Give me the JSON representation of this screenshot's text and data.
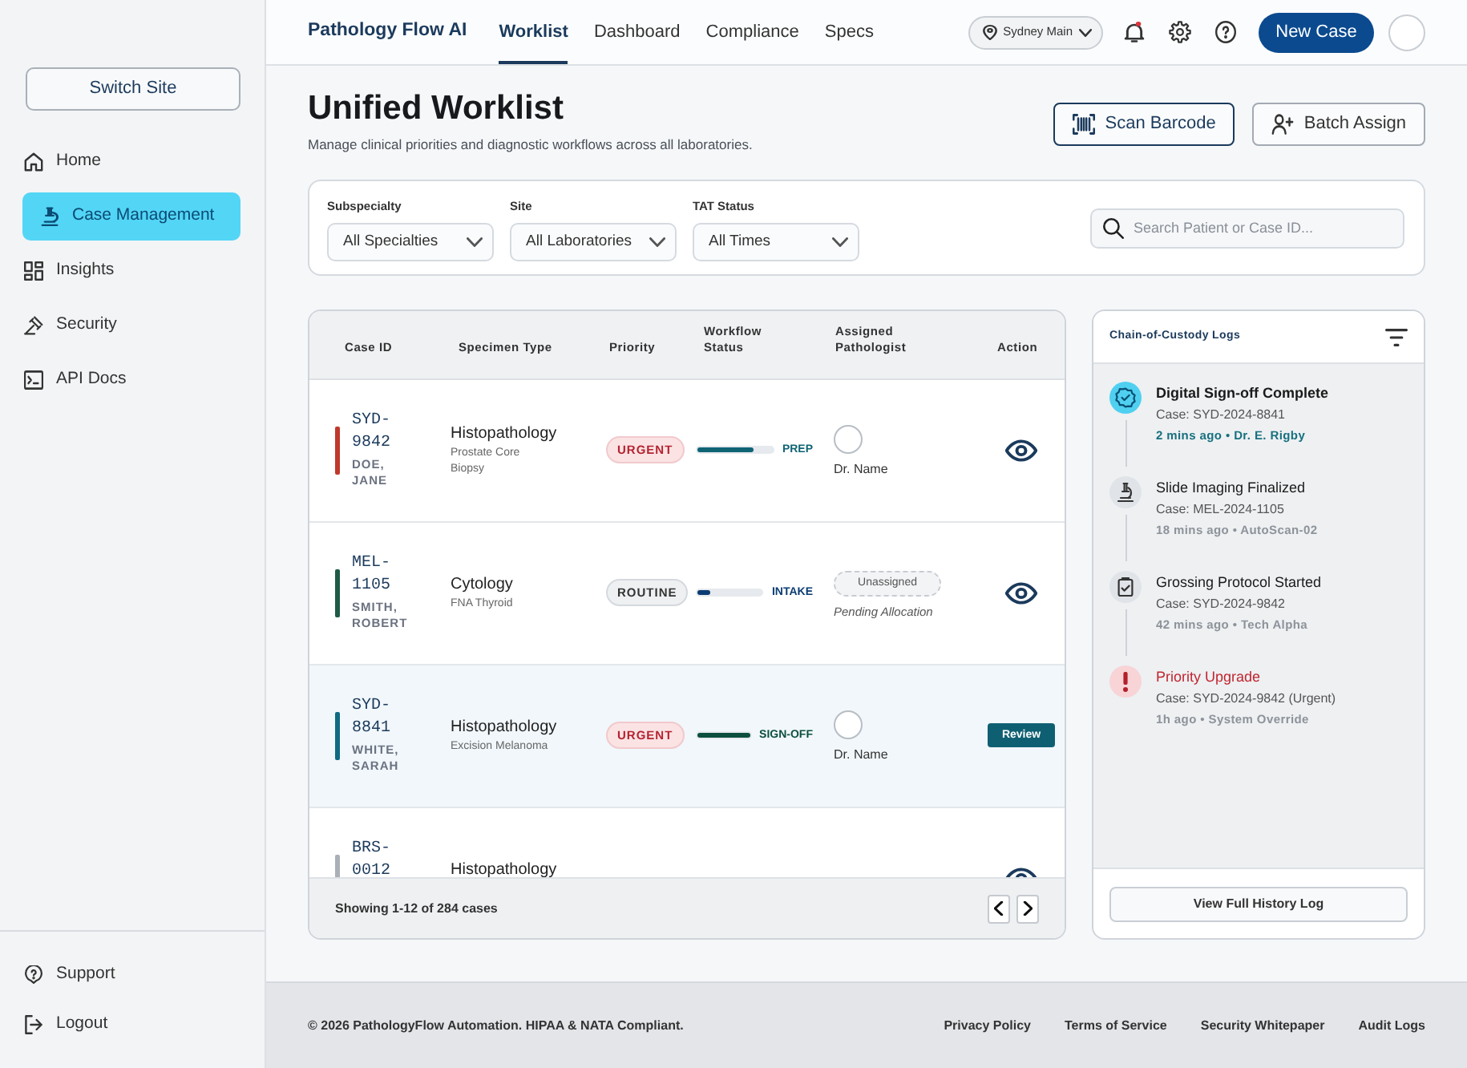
{
  "sidebar": {
    "switch_button": "Switch Site",
    "items": [
      {
        "label": "Home",
        "selected": false
      },
      {
        "label": "Case Management",
        "selected": true
      },
      {
        "label": "Insights",
        "selected": false
      },
      {
        "label": "Security",
        "selected": false
      },
      {
        "label": "API Docs",
        "selected": false
      }
    ],
    "bottom_items": [
      {
        "label": "Support"
      },
      {
        "label": "Logout"
      }
    ]
  },
  "topbar": {
    "brand": "Pathology Flow AI",
    "tabs": [
      {
        "label": "Worklist",
        "selected": true
      },
      {
        "label": "Dashboard",
        "selected": false
      },
      {
        "label": "Compliance",
        "selected": false
      },
      {
        "label": "Specs",
        "selected": false
      }
    ],
    "location": "Sydney Main",
    "notifications_unread": true,
    "new_case_button": "New Case"
  },
  "header": {
    "title": "Unified Worklist",
    "subtitle": "Manage clinical priorities and diagnostic workflows across all laboratories.",
    "buttons": [
      {
        "label": "Scan Barcode",
        "kind": "primary"
      },
      {
        "label": "Batch Assign",
        "kind": "secondary"
      }
    ]
  },
  "filters": [
    {
      "label": "Subspecialty",
      "value": "All Specialties"
    },
    {
      "label": "Site",
      "value": "All Laboratories"
    },
    {
      "label": "TAT Status",
      "value": "All Times"
    }
  ],
  "search": {
    "placeholder": "Search Patient or Case ID..."
  },
  "table": {
    "columns": [
      "Case ID",
      "Specimen Type",
      "Priority",
      "Workflow Status",
      "Assigned Pathologist",
      "Action"
    ],
    "rows": [
      {
        "case_id": "SYD-9842",
        "patient": "DOE, JANE",
        "color": "#c0392b",
        "selected": false,
        "specimen": "Histopathology",
        "detail": "Prostate Core Biopsy",
        "priority": {
          "label": "URGENT",
          "kind": "urgent"
        },
        "status": {
          "label": "PREP",
          "level": 0.75,
          "color": "#0f6474"
        },
        "pathologist": {
          "kind": "assigned",
          "name": "Dr. Name"
        },
        "action": {
          "kind": "view"
        }
      },
      {
        "case_id": "MEL-1105",
        "patient": "SMITH, ROBERT",
        "color": "#1e5a46",
        "selected": false,
        "specimen": "Cytology",
        "detail": "FNA Thyroid",
        "priority": {
          "label": "ROUTINE",
          "kind": "routine"
        },
        "status": {
          "label": "INTAKE",
          "level": 0.2,
          "color": "#0b3d73"
        },
        "pathologist": {
          "kind": "unassigned",
          "tag": "Unassigned",
          "note": "Pending Allocation"
        },
        "action": {
          "kind": "view"
        }
      },
      {
        "case_id": "SYD-8841",
        "patient": "WHITE, SARAH",
        "color": "#0f6b80",
        "selected": true,
        "specimen": "Histopathology",
        "detail": "Excision Melanoma",
        "priority": {
          "label": "URGENT",
          "kind": "urgent"
        },
        "status": {
          "label": "SIGN-OFF",
          "level": 1,
          "color": "#0c4f3f"
        },
        "pathologist": {
          "kind": "assigned",
          "name": "Dr. Name"
        },
        "action": {
          "kind": "review",
          "label": "Review"
        }
      },
      {
        "case_id": "BRS-0012",
        "color": "#a9b0b8",
        "selected": false,
        "specimen": "Histopathology",
        "action": {
          "kind": "view"
        }
      }
    ],
    "footer": "Showing 1-12 of 284 cases"
  },
  "logs": {
    "title": "Chain-of-Custody Logs",
    "items": [
      {
        "kind": "signoff",
        "title": "Digital Sign-off Complete",
        "case": "Case: SYD-2024-8841",
        "meta": "2 mins ago • Dr. E. Rigby"
      },
      {
        "kind": "imaging",
        "title": "Slide Imaging Finalized",
        "case": "Case: MEL-2024-1105",
        "meta": "18 mins ago • AutoScan-02"
      },
      {
        "kind": "grossing",
        "title": "Grossing Protocol Started",
        "case": "Case: SYD-2024-9842",
        "meta": "42 mins ago • Tech Alpha"
      },
      {
        "kind": "alert",
        "title": "Priority Upgrade",
        "case": "Case: SYD-2024-9842 (Urgent)",
        "meta": "1h ago • System Override"
      }
    ],
    "button": "View Full History Log"
  },
  "footer": {
    "copyright": "© 2026 PathologyFlow Automation. HIPAA & NATA Compliant.",
    "links": [
      "Privacy Policy",
      "Terms of Service",
      "Security Whitepaper",
      "Audit Logs"
    ]
  }
}
